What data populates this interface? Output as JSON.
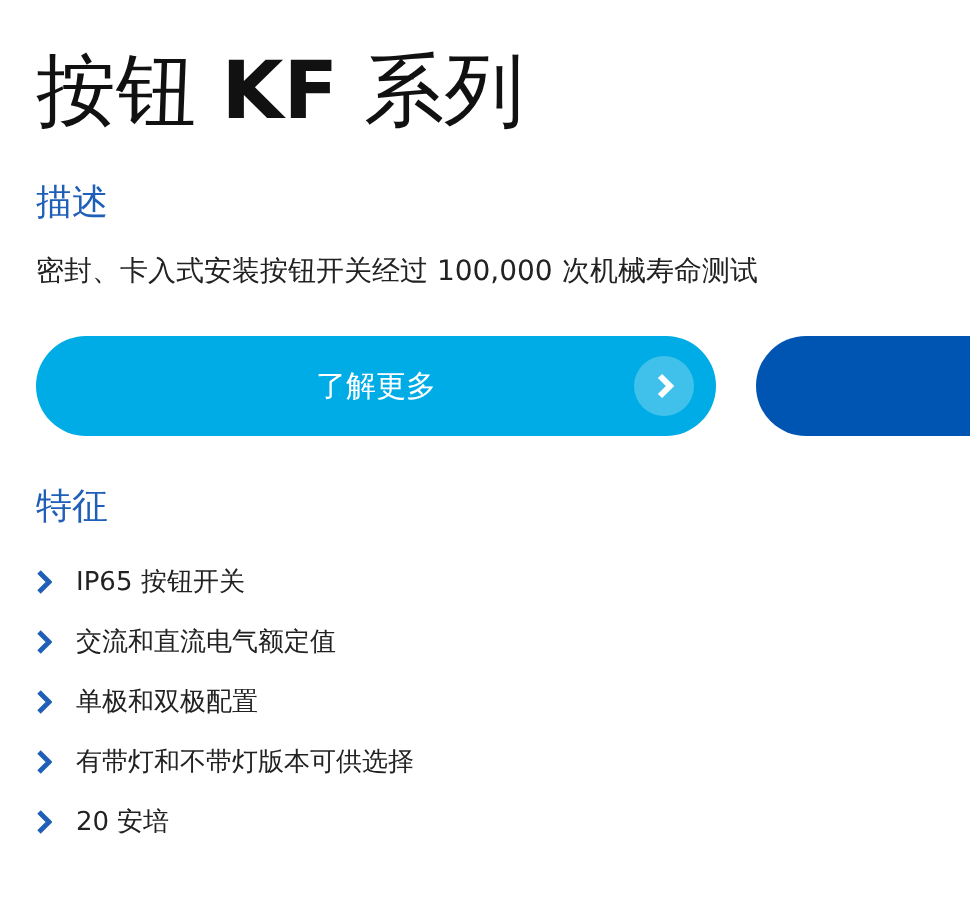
{
  "title": "按钮 **KF** 系列",
  "description": {
    "heading": "描述",
    "text": "密封、卡入式安装按钮开关经过 100,000 次机械寿命测试"
  },
  "buttons": [
    {
      "kind": "primary",
      "label": "了解更多"
    },
    {
      "kind": "secondary"
    }
  ],
  "features": {
    "heading": "特征",
    "items": [
      "IP65 按钮开关",
      "交流和直流电气额定值",
      "单极和双极配置",
      "有带灯和不带灯版本可供选择",
      "20 安培"
    ]
  }
}
